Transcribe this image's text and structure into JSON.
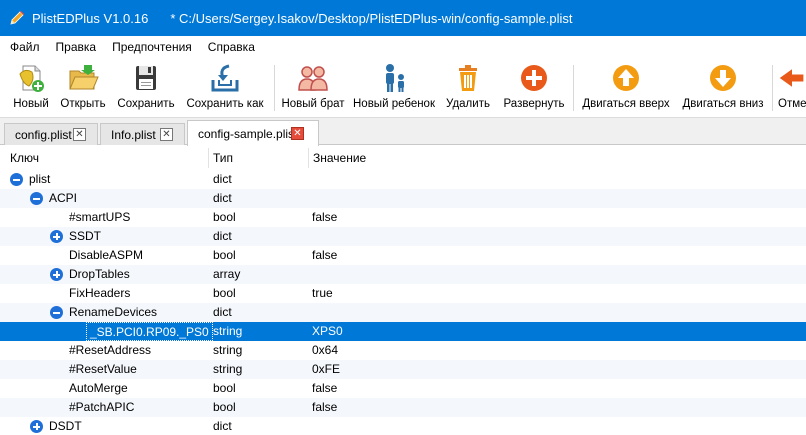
{
  "window": {
    "app_title": "PlistEDPlus V1.0.16",
    "file_path": "* C:/Users/Sergey.Isakov/Desktop/PlistEDPlus-win/config-sample.plist"
  },
  "menu": [
    "Файл",
    "Правка",
    "Предпочтения",
    "Справка"
  ],
  "toolbar": {
    "new": "Новый",
    "open": "Открыть",
    "save": "Сохранить",
    "save_as": "Сохранить как",
    "new_sibling": "Новый брат",
    "new_child": "Новый ребенок",
    "delete": "Удалить",
    "expand": "Развернуть",
    "move_up": "Двигаться вверх",
    "move_down": "Двигаться вниз",
    "undo_partial": "Отме"
  },
  "tabs": [
    {
      "label": "config.plist",
      "active": false
    },
    {
      "label": "Info.plist",
      "active": false
    },
    {
      "label": "config-sample.plist",
      "active": true
    }
  ],
  "columns": {
    "key": "Ключ",
    "type": "Тип",
    "value": "Значение"
  },
  "rows": [
    {
      "key": "plist",
      "type": "dict",
      "value": "",
      "expander": "expanded"
    },
    {
      "key": "ACPI",
      "type": "dict",
      "value": "",
      "expander": "expanded"
    },
    {
      "key": "#smartUPS",
      "type": "bool",
      "value": "false",
      "expander": "none"
    },
    {
      "key": "SSDT",
      "type": "dict",
      "value": "",
      "expander": "collapsed"
    },
    {
      "key": "DisableASPM",
      "type": "bool",
      "value": "false",
      "expander": "none"
    },
    {
      "key": "DropTables",
      "type": "array",
      "value": "",
      "expander": "collapsed"
    },
    {
      "key": "FixHeaders",
      "type": "bool",
      "value": "true",
      "expander": "none"
    },
    {
      "key": "RenameDevices",
      "type": "dict",
      "value": "",
      "expander": "expanded"
    },
    {
      "key": "_SB.PCI0.RP09._PS0",
      "type": "string",
      "value": "XPS0",
      "expander": "none",
      "selected": true
    },
    {
      "key": "#ResetAddress",
      "type": "string",
      "value": "0x64",
      "expander": "none"
    },
    {
      "key": "#ResetValue",
      "type": "string",
      "value": "0xFE",
      "expander": "none"
    },
    {
      "key": "AutoMerge",
      "type": "bool",
      "value": "false",
      "expander": "none"
    },
    {
      "key": "#PatchAPIC",
      "type": "bool",
      "value": "false",
      "expander": "none"
    },
    {
      "key": "DSDT",
      "type": "dict",
      "value": "",
      "expander": "collapsed"
    }
  ],
  "colors": {
    "accent": "#0078d7",
    "expander": "#1e6fd8",
    "tab_close_active": "#e64c3c"
  }
}
